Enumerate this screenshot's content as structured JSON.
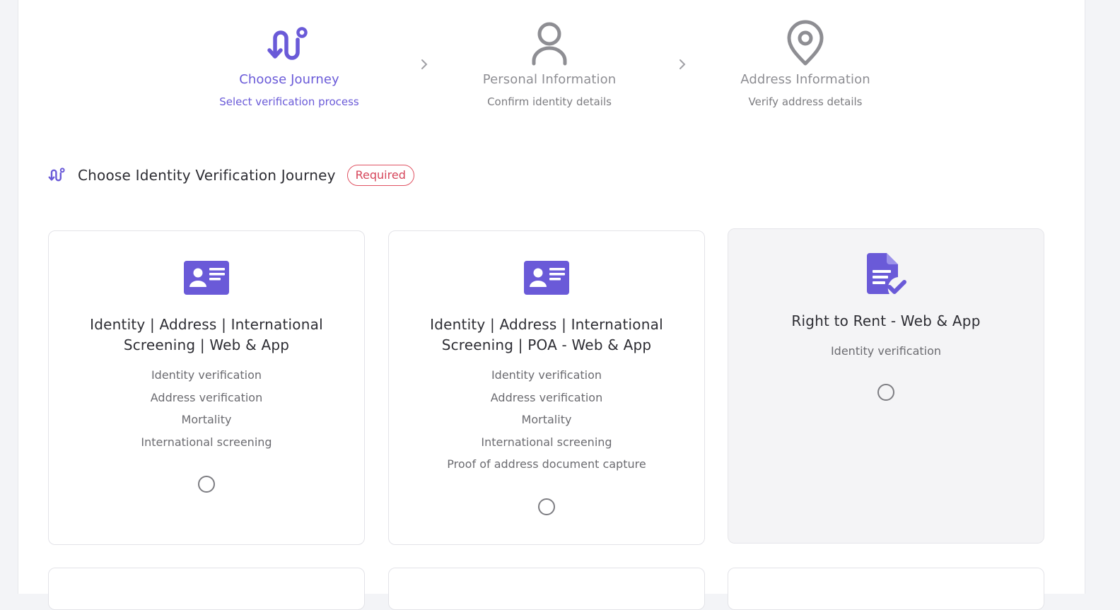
{
  "stepper": [
    {
      "title": "Choose Journey",
      "subtitle": "Select verification process",
      "state": "active",
      "icon": "route-icon"
    },
    {
      "title": "Personal Information",
      "subtitle": "Confirm identity details",
      "state": "inactive",
      "icon": "user-icon"
    },
    {
      "title": "Address Information",
      "subtitle": "Verify address details",
      "state": "inactive",
      "icon": "map-pin-icon"
    }
  ],
  "section": {
    "title": "Choose Identity Verification Journey",
    "badge": "Required",
    "icon": "route-icon"
  },
  "cards": [
    {
      "title": "Identity | Address | International Screening | Web & App",
      "features": [
        "Identity verification",
        "Address verification",
        "Mortality",
        "International screening"
      ],
      "icon": "id-card-icon",
      "selected": false
    },
    {
      "title": "Identity | Address | International Screening | POA - Web & App",
      "features": [
        "Identity verification",
        "Address verification",
        "Mortality",
        "International screening",
        "Proof of address document capture"
      ],
      "icon": "id-card-icon",
      "selected": false
    },
    {
      "title": "Right to Rent - Web & App",
      "features": [
        "Identity verification"
      ],
      "icon": "document-check-icon",
      "selected": false
    }
  ],
  "colors": {
    "accent": "#6a5ad8",
    "required": "#d6455a",
    "muted": "#8e8e93"
  }
}
